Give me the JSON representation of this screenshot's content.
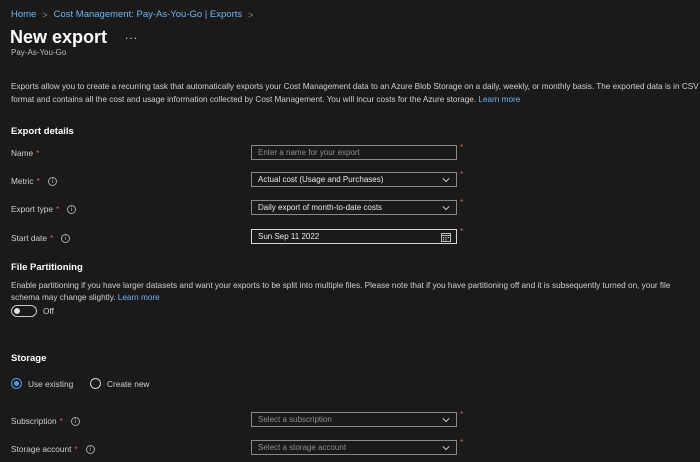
{
  "breadcrumb": [
    "Home",
    "Cost Management: Pay-As-You-Go | Exports"
  ],
  "page": {
    "title": "New export",
    "more": "...",
    "subtitle": "Pay-As-You-Go"
  },
  "description": {
    "text": "Exports allow you to create a recurring task that automatically exports your Cost Management data to an Azure Blob Storage on a daily, weekly, or monthly basis. The exported data is in CSV format and contains all the cost and usage information collected by Cost Management. You will incur costs for the Azure storage.",
    "link": "Learn more"
  },
  "export_details": {
    "heading": "Export details",
    "name_label": "Name",
    "name_placeholder": "Enter a name for your export",
    "metric_label": "Metric",
    "metric_value": "Actual cost (Usage and Purchases)",
    "export_type_label": "Export type",
    "export_type_value": "Daily export of month-to-date costs",
    "start_date_label": "Start date",
    "start_date_value": "Sun Sep 11 2022"
  },
  "file_partitioning": {
    "heading": "File Partitioning",
    "text": "Enable partitioning if you have larger datasets and want your exports to be split into multiple files. Please note that if you have partitioning off and it is subsequently turned on, your file schema may change slightly.",
    "link": "Learn more",
    "toggle_label": "Off"
  },
  "storage": {
    "heading": "Storage",
    "use_existing": "Use existing",
    "create_new": "Create new",
    "subscription_label": "Subscription",
    "subscription_placeholder": "Select a subscription",
    "storage_account_label": "Storage account",
    "storage_account_placeholder": "Select a storage account"
  },
  "colors": {
    "background": "#1b1a19",
    "link": "#6db5f5",
    "required": "#e0615f",
    "accent": "#4f9fe8"
  }
}
